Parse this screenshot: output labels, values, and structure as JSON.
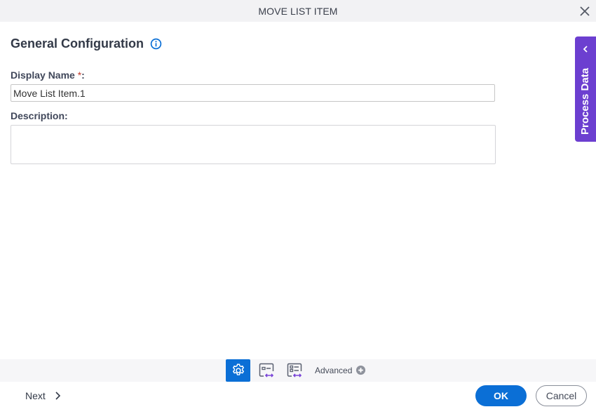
{
  "dialog": {
    "title": "MOVE LIST ITEM",
    "close_icon": "close-icon"
  },
  "section": {
    "title": "General Configuration",
    "info_icon": "info-icon"
  },
  "fields": {
    "display_name": {
      "label": "Display Name ",
      "required_marker": "*",
      "suffix": ":",
      "value": "Move List Item.1"
    },
    "description": {
      "label": "Description:",
      "value": ""
    }
  },
  "side_panel": {
    "label": "Process Data",
    "icon": "chevron-left-icon"
  },
  "toolbar": {
    "buttons": [
      {
        "name": "settings",
        "icon": "gear-icon",
        "active": true
      },
      {
        "name": "input-mapping",
        "icon": "form-mapping-icon",
        "active": false
      },
      {
        "name": "output-mapping",
        "icon": "list-mapping-icon",
        "active": false
      }
    ],
    "advanced_label": "Advanced",
    "advanced_icon": "plus-circle-icon"
  },
  "footer": {
    "next_label": "Next",
    "ok_label": "OK",
    "cancel_label": "Cancel"
  },
  "colors": {
    "accent": "#0b6fd6",
    "side_panel": "#6c3fd0",
    "required": "#c0392b"
  }
}
